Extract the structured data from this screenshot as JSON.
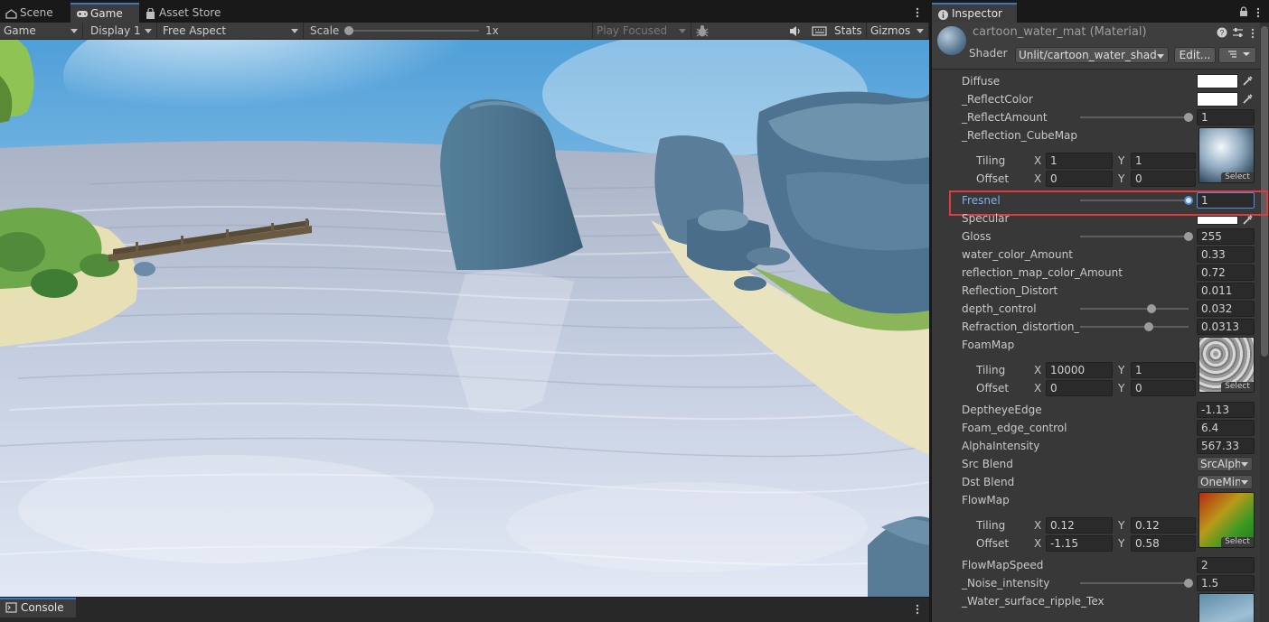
{
  "tabs": {
    "scene": "Scene",
    "game": "Game",
    "asset_store": "Asset Store",
    "inspector": "Inspector"
  },
  "toolbar": {
    "view_mode": "Game",
    "display": "Display 1",
    "aspect": "Free Aspect",
    "scale_label": "Scale",
    "scale_value": "1x",
    "play_mode": "Play Focused",
    "stats": "Stats",
    "gizmos": "Gizmos"
  },
  "console": {
    "title": "Console"
  },
  "inspector": {
    "material_name": "cartoon_water_mat (Material)",
    "shader_label": "Shader",
    "shader_value": "Unlit/cartoon_water_shader",
    "edit_button": "Edit...",
    "properties": {
      "diffuse": "Diffuse",
      "reflect_color": "_ReflectColor",
      "reflect_amount": "_ReflectAmount",
      "reflect_amount_value": "1",
      "reflection_cubemap": "_Reflection_CubeMap",
      "fresnel": "Fresnel",
      "fresnel_value": "1",
      "specular": "Specular",
      "gloss": "Gloss",
      "gloss_value": "255",
      "water_color_amount": "water_color_Amount",
      "water_color_amount_value": "0.33",
      "reflection_map_color_amount": "reflection_map_color_Amount",
      "reflection_map_color_amount_value": "0.72",
      "reflection_distort": "Reflection_Distort",
      "reflection_distort_value": "0.011",
      "depth_control": "depth_control",
      "depth_control_value": "0.032",
      "refraction_distortion": "Refraction_distortion_uv",
      "refraction_distortion_value": "0.0313",
      "foam_map": "FoamMap",
      "deptheye_edge": "DeptheyeEdge",
      "deptheye_edge_value": "-1.13",
      "foam_edge_control": "Foam_edge_control",
      "foam_edge_control_value": "6.4",
      "alpha_intensity": "AlphaIntensity",
      "alpha_intensity_value": "567.33",
      "src_blend": "Src Blend",
      "src_blend_value": "SrcAlpha",
      "dst_blend": "Dst Blend",
      "dst_blend_value": "OneMinus",
      "flow_map": "FlowMap",
      "flow_map_speed": "FlowMapSpeed",
      "flow_map_speed_value": "2",
      "noise_intensity": "_Noise_intensity",
      "noise_intensity_value": "1.5",
      "water_surface_ripple": "_Water_surface_ripple_Tex"
    },
    "tiling_label": "Tiling",
    "offset_label": "Offset",
    "x_label": "X",
    "y_label": "Y",
    "select_label": "Select",
    "cubemap_tiling_x": "1",
    "cubemap_tiling_y": "1",
    "cubemap_offset_x": "0",
    "cubemap_offset_y": "0",
    "foam_tiling_x": "10000",
    "foam_tiling_y": "1",
    "foam_offset_x": "0",
    "foam_offset_y": "0",
    "flow_tiling_x": "0.12",
    "flow_tiling_y": "0.12",
    "flow_offset_x": "-1.15",
    "flow_offset_y": "0.58",
    "slider_levels": {
      "reflect_amount": 1.0,
      "fresnel": 1.0,
      "gloss": 1.0,
      "depth_control": 0.66,
      "refraction_distortion": 0.63,
      "noise_intensity": 1.0
    }
  },
  "highlight": {
    "target": "fresnel",
    "color": "#e03a3a"
  }
}
